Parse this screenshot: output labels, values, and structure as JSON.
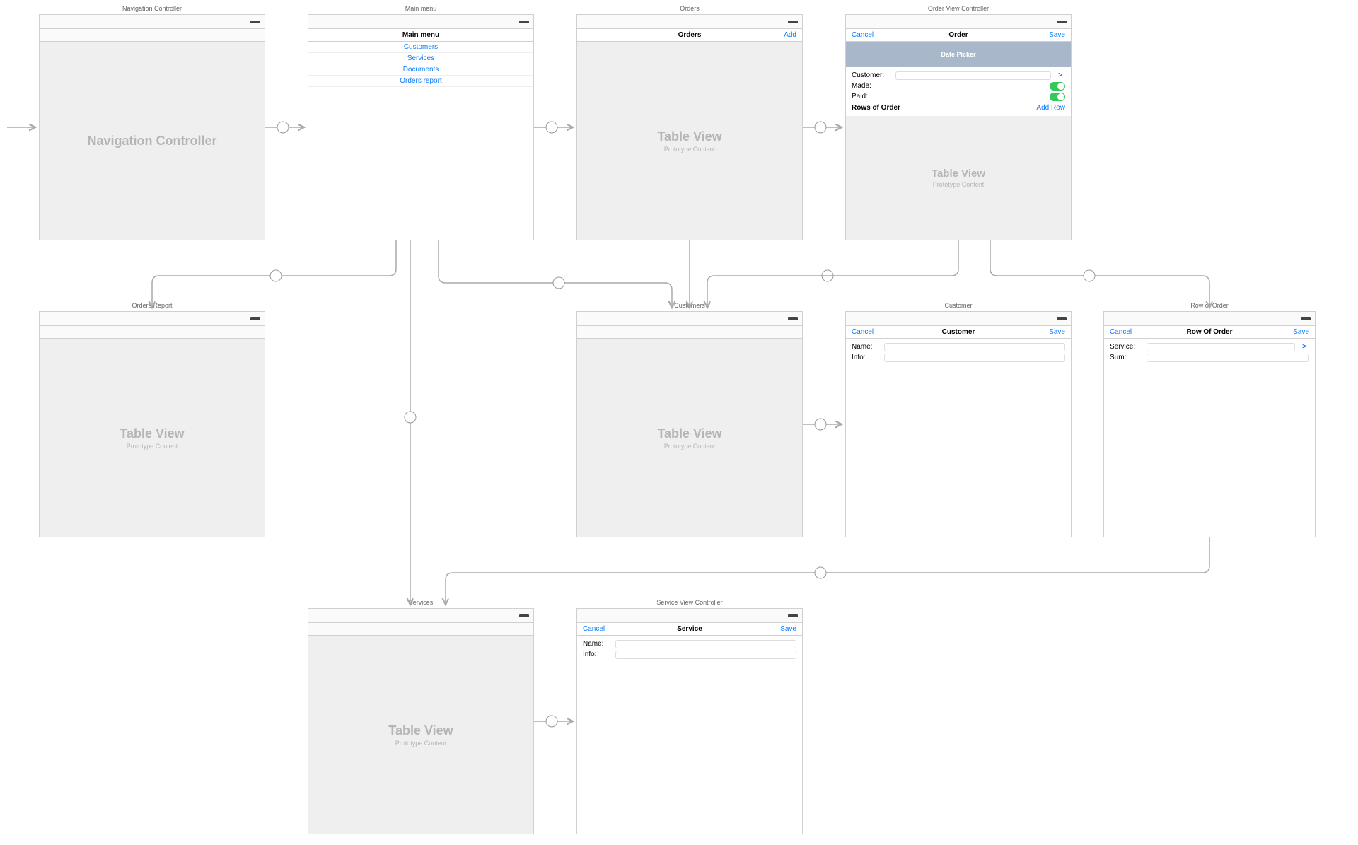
{
  "scenes": {
    "navController": {
      "label": "Navigation Controller",
      "placeholderTitle": "Navigation Controller"
    },
    "mainMenu": {
      "label": "Main menu",
      "title": "Main menu",
      "items": [
        "Customers",
        "Services",
        "Documents",
        "Orders report"
      ]
    },
    "orders": {
      "label": "Orders",
      "title": "Orders",
      "rightBtn": "Add",
      "placeholderTitle": "Table View",
      "placeholderSub": "Prototype Content"
    },
    "orderVC": {
      "label": "Order View Controller",
      "leftBtn": "Cancel",
      "title": "Order",
      "rightBtn": "Save",
      "datePicker": "Date Picker",
      "fields": {
        "customer": "Customer:",
        "made": "Made:",
        "paid": "Paid:"
      },
      "rowsHeader": "Rows of Order",
      "addRow": "Add Row",
      "placeholderTitle": "Table View",
      "placeholderSub": "Prototype Content"
    },
    "ordersReport": {
      "label": "Orders Report",
      "placeholderTitle": "Table View",
      "placeholderSub": "Prototype Content"
    },
    "customers": {
      "label": "Customers",
      "placeholderTitle": "Table View",
      "placeholderSub": "Prototype Content"
    },
    "customer": {
      "label": "Customer",
      "leftBtn": "Cancel",
      "title": "Customer",
      "rightBtn": "Save",
      "fields": {
        "name": "Name:",
        "info": "Info:"
      }
    },
    "rowOfOrder": {
      "label": "Row of Order",
      "leftBtn": "Cancel",
      "title": "Row Of Order",
      "rightBtn": "Save",
      "fields": {
        "service": "Service:",
        "sum": "Sum:"
      }
    },
    "services": {
      "label": "Services",
      "placeholderTitle": "Table View",
      "placeholderSub": "Prototype Content"
    },
    "serviceVC": {
      "label": "Service View Controller",
      "leftBtn": "Cancel",
      "title": "Service",
      "rightBtn": "Save",
      "fields": {
        "name": "Name:",
        "info": "Info:"
      }
    }
  }
}
